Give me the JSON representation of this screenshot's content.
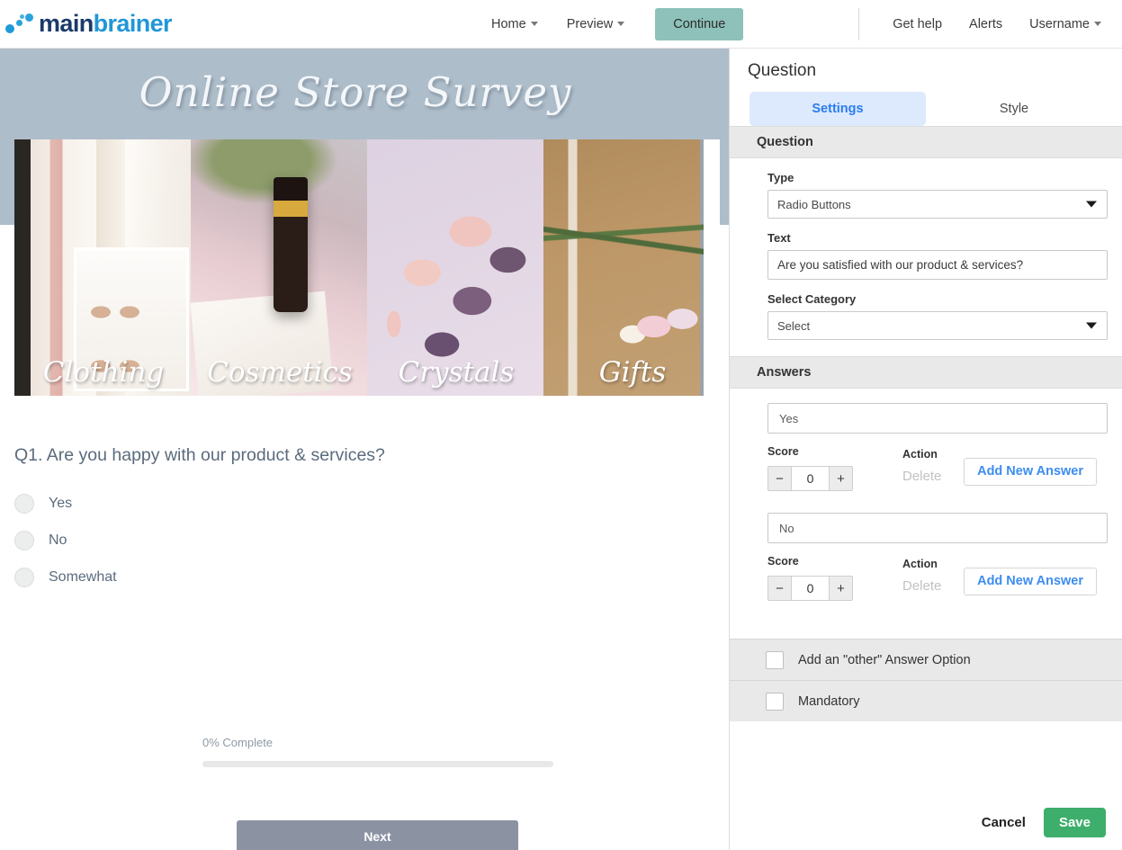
{
  "nav": {
    "brand_main": "main",
    "brand_sub": "brainer",
    "home": "Home",
    "preview": "Preview",
    "continue": "Continue",
    "get_help": "Get help",
    "alerts": "Alerts",
    "username": "Username",
    "continue_color": "#8dc1b9"
  },
  "preview": {
    "banner_title": "Online Store Survey",
    "banner_color": "#aebdca",
    "tiles": [
      {
        "label": "Clothing",
        "art": "img-clothing"
      },
      {
        "label": "Cosmetics",
        "art": "img-cosmetics"
      },
      {
        "label": "Crystals",
        "art": "img-crystals"
      },
      {
        "label": "Gifts",
        "art": "img-gifts"
      }
    ],
    "question_text": "Q1. Are you happy with our product & services?",
    "options": [
      {
        "label": "Yes"
      },
      {
        "label": "No"
      },
      {
        "label": "Somewhat"
      }
    ],
    "progress_label": "0% Complete",
    "progress_percent": 0,
    "next_label": "Next",
    "next_color": "#8b93a3"
  },
  "panel": {
    "title": "Question",
    "tabs": [
      {
        "label": "Settings",
        "active": true
      },
      {
        "label": "Style",
        "active": false
      }
    ],
    "question_section": {
      "heading": "Question",
      "type_label": "Type",
      "type_value": "Radio Buttons",
      "text_label": "Text",
      "text_value": "Are you satisfied with our product & services?",
      "category_label": "Select Category",
      "category_value": "Select"
    },
    "answers_section": {
      "heading": "Answers",
      "score_label": "Score",
      "action_label": "Action",
      "delete_label": "Delete",
      "add_label": "Add New Answer",
      "items": [
        {
          "text": "Yes",
          "score": "0"
        },
        {
          "text": "No",
          "score": "0"
        }
      ],
      "minus": "−",
      "plus": "+"
    },
    "checkboxes": [
      {
        "label": "Add an \"other\" Answer Option",
        "checked": false
      },
      {
        "label": "Mandatory",
        "checked": false
      }
    ],
    "footer": {
      "cancel": "Cancel",
      "save": "Save",
      "save_color": "#3dae6b"
    }
  }
}
